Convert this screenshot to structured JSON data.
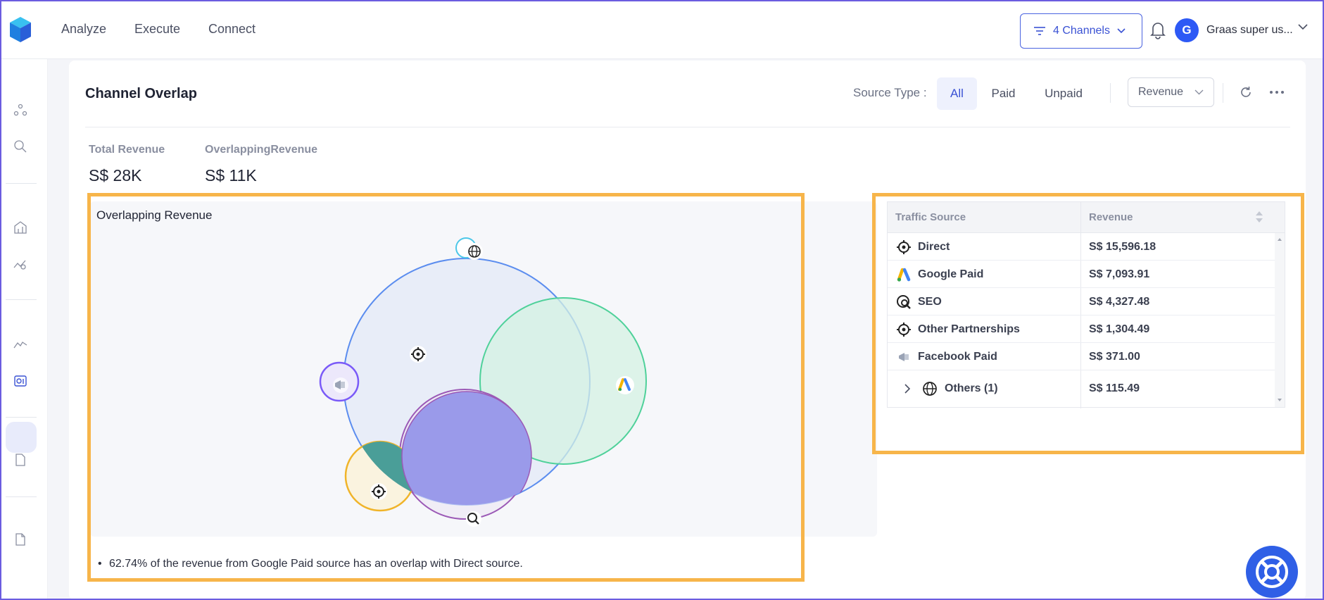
{
  "nav": {
    "links": [
      "Analyze",
      "Execute",
      "Connect"
    ],
    "channels_label": "4 Channels",
    "avatar_initial": "G",
    "username": "Graas super us..."
  },
  "header": {
    "title": "Channel Overlap",
    "source_type_label": "Source Type :",
    "segments": [
      "All",
      "Paid",
      "Unpaid"
    ],
    "active_segment": "All",
    "metric": "Revenue"
  },
  "kpis": [
    {
      "label": "Total Revenue",
      "value": "S$ 28K"
    },
    {
      "label": "OverlappingRevenue",
      "value": "S$ 11K"
    }
  ],
  "chart": {
    "title": "Overlapping Revenue",
    "insight": "62.74% of the revenue from Google Paid source has an overlap with Direct source."
  },
  "table": {
    "columns": [
      "Traffic Source",
      "Revenue"
    ],
    "rows": [
      {
        "icon": "target-icon",
        "name": "Direct",
        "revenue": "S$ 15,596.18"
      },
      {
        "icon": "google-ads-icon",
        "name": "Google Paid",
        "revenue": "S$ 7,093.91"
      },
      {
        "icon": "seo-icon",
        "name": "SEO",
        "revenue": "S$ 4,327.48"
      },
      {
        "icon": "target-icon",
        "name": "Other Partnerships",
        "revenue": "S$ 1,304.49"
      },
      {
        "icon": "megaphone-icon",
        "name": "Facebook Paid",
        "revenue": "S$ 371.00"
      },
      {
        "icon": "globe-icon",
        "name": "Others (1)",
        "revenue": "S$ 115.49"
      }
    ]
  },
  "colors": {
    "accent": "#3a52d4",
    "highlight": "#f7b54a",
    "direct": "#5b8def",
    "google": "#4fd19a",
    "seo": "#9b59b6",
    "partnerships": "#f0b429",
    "facebook": "#7a5af8"
  }
}
